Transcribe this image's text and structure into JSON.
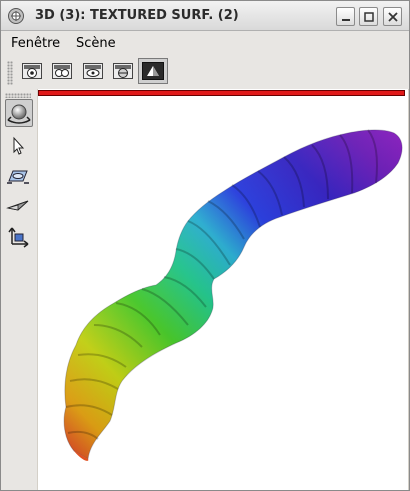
{
  "window": {
    "title": "3D (3): TEXTURED SURF. (2)",
    "app_icon": "app-logo-icon",
    "controls": [
      "minimize-icon",
      "maximize-icon",
      "close-icon"
    ]
  },
  "menubar": {
    "items": [
      {
        "label": "Fenêtre"
      },
      {
        "label": "Scène"
      }
    ]
  },
  "toolbar": {
    "buttons": [
      {
        "icon": "render-mode-1-icon"
      },
      {
        "icon": "render-mode-2-icon"
      },
      {
        "icon": "render-mode-3-icon"
      },
      {
        "icon": "render-mode-4-icon"
      },
      {
        "icon": "render-mode-5-icon",
        "active": true
      }
    ],
    "progress_bar_color": "#e01919"
  },
  "sidebar": {
    "tools": [
      {
        "icon": "rotate-icon",
        "active": true
      },
      {
        "icon": "pointer-icon"
      },
      {
        "icon": "pan-icon"
      },
      {
        "icon": "zoom-icon"
      },
      {
        "icon": "axes-icon"
      }
    ]
  },
  "viewport": {
    "content": "textured-surface",
    "colormap": [
      "#e0301a",
      "#e8a000",
      "#c8d800",
      "#3ccf1a",
      "#12cc8a",
      "#1ab0d8",
      "#1830e8",
      "#2a14c8",
      "#6a12c0",
      "#8a14c8"
    ]
  }
}
